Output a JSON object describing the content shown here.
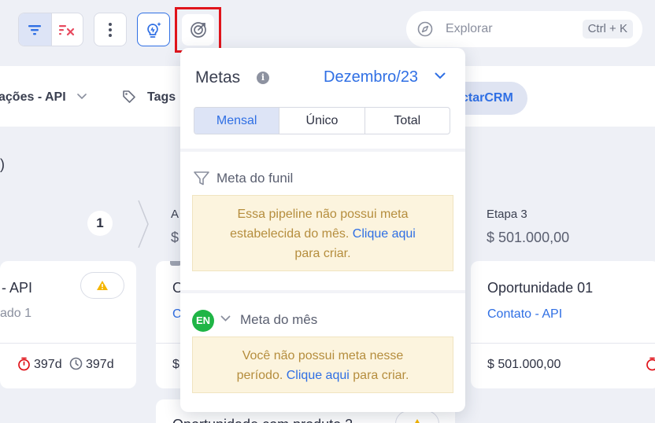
{
  "toolbar": {
    "search_placeholder": "Explorar",
    "search_shortcut": "Ctrl + K"
  },
  "filters": {
    "integration_label": "ações - API",
    "tags_label": "Tags",
    "pill_label": "ctarCRM"
  },
  "board": {
    "paren": ")",
    "count_badge": "1",
    "stage_a_name": "A",
    "stage_a_value": "$",
    "stage3_name": "Etapa 3",
    "stage3_value": "$ 501.000,00",
    "card_left": {
      "title": "- API",
      "subtitle": "ado 1",
      "timer1": "397d",
      "timer2": "397d"
    },
    "card_mid": {
      "title": "O",
      "link": "C",
      "value": "$"
    },
    "card_right": {
      "title": "Oportunidade 01",
      "link": "Contato - API",
      "value": "$ 501.000,00"
    },
    "card_bottom": {
      "title": "Oportunidade com produto 2"
    }
  },
  "popover": {
    "title": "Metas",
    "month": "Dezembro/23",
    "tabs": [
      {
        "label": "Mensal",
        "active": true
      },
      {
        "label": "Único",
        "active": false
      },
      {
        "label": "Total",
        "active": false
      }
    ],
    "funnel_section": {
      "title": "Meta do funil",
      "note_text_1": "Essa pipeline não possui meta",
      "note_text_2": "estabelecida do mês.",
      "note_link": "Clique aqui",
      "note_text_3": "para criar."
    },
    "month_section": {
      "avatar": "EN",
      "title": "Meta do mês",
      "note_text_1": "Você não possui meta nesse",
      "note_text_2": "período.",
      "note_link": "Clique aqui",
      "note_text_3": "para criar."
    }
  },
  "colors": {
    "accent": "#2f6fe4",
    "highlight": "#e0141b",
    "note_bg": "#fcf4de",
    "note_text": "#b58d3d",
    "avatar": "#1fb546",
    "timer_red": "#e0141b"
  }
}
